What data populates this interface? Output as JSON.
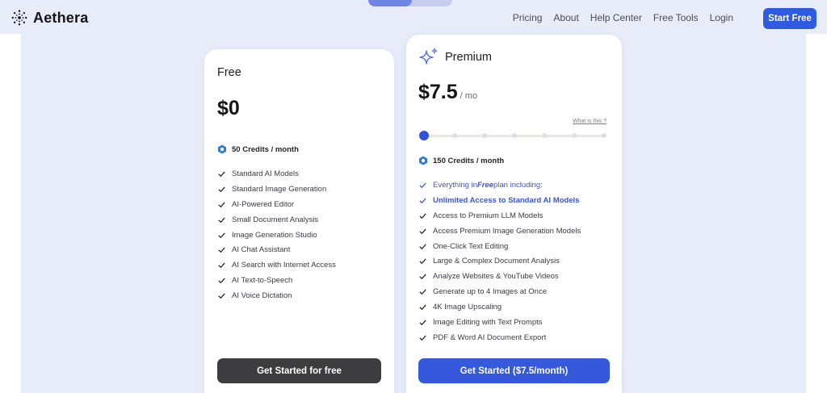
{
  "brand": {
    "name": "Aethera"
  },
  "nav": {
    "items": [
      {
        "label": "Pricing"
      },
      {
        "label": "About"
      },
      {
        "label": "Help Center"
      },
      {
        "label": "Free Tools"
      },
      {
        "label": "Login"
      }
    ],
    "cta_label": "Start Free"
  },
  "billing_toggle": {
    "selected_fraction": 0.5
  },
  "colors": {
    "accent": "#2f5be0",
    "background": "#e8ebf8",
    "dark_button": "#3d3d40"
  },
  "plans": {
    "free": {
      "name": "Free",
      "price": "$0",
      "credits": "50 Credits / month",
      "features": [
        "Standard AI Models",
        "Standard Image Generation",
        "AI-Powered Editor",
        "Small Document Analysis",
        "Image Generation Studio",
        "AI Chat Assistant",
        "AI Search with Internet Access",
        "AI Text-to-Speech",
        "AI Voice Dictation"
      ],
      "cta_label": "Get Started for free"
    },
    "premium": {
      "name": "Premium",
      "price": "$7.5",
      "period": "/ mo",
      "what_is_this": "What is this ?",
      "slider": {
        "steps": 7,
        "selected_index": 0
      },
      "credits": "150 Credits / month",
      "intro": {
        "prefix": "Everything in ",
        "plan": "Free",
        "suffix": " plan including:"
      },
      "unlimited": "Unlimited Access to Standard AI Models",
      "features": [
        "Access to Premium LLM Models",
        "Access Premium Image Generation Models",
        "One-Click Text Editing",
        "Large & Complex Document Analysis",
        "Analyze Websites & YouTube Videos",
        "Generate up to 4 Images at Once",
        "4K Image Upscaling",
        "Image Editing with Text Prompts",
        "PDF & Word AI Document Export"
      ],
      "cta_label": "Get Started ($7.5/month)"
    }
  }
}
